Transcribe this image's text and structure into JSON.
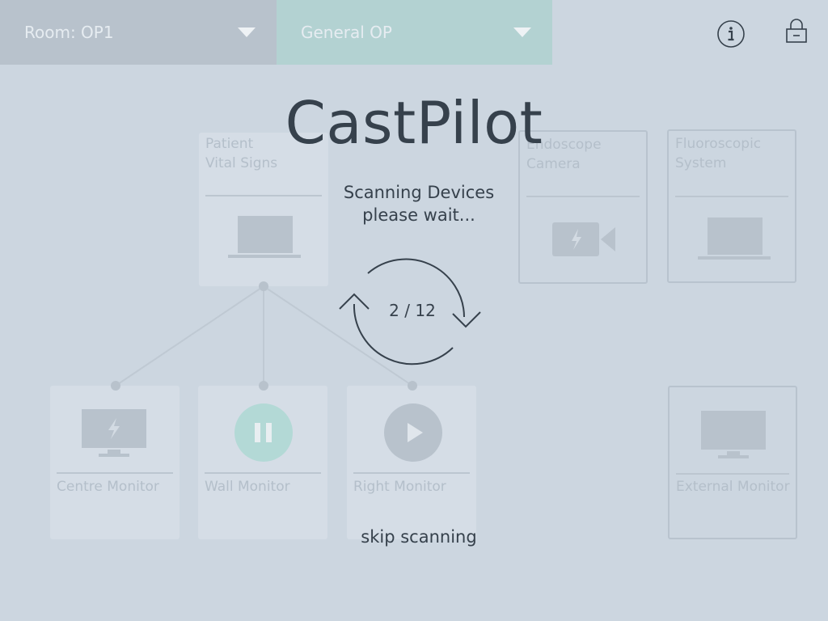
{
  "header": {
    "room_dropdown": "Room: OP1",
    "mode_dropdown": "General OP",
    "info_icon": "info-icon",
    "lock_icon": "lock-icon"
  },
  "overlay": {
    "app_title": "CastPilot",
    "scan_line1": "Scanning Devices",
    "scan_line2": "please wait...",
    "progress": "2 / 12",
    "skip": "skip scanning"
  },
  "devices": {
    "sources": [
      {
        "label": "Patient\nVital Signs",
        "icon": "laptop-icon"
      },
      {
        "label": "Endoscope\nCamera",
        "icon": "camera-icon"
      },
      {
        "label": "Fluoroscopic\nSystem",
        "icon": "laptop-icon"
      }
    ],
    "displays": [
      {
        "label": "Centre Monitor",
        "icon": "monitor-icon"
      },
      {
        "label": "Wall Monitor",
        "icon": "pause-icon"
      },
      {
        "label": "Right Monitor",
        "icon": "play-icon"
      },
      {
        "label": "External Monitor",
        "icon": "monitor-icon"
      }
    ]
  },
  "colors": {
    "background": "#ccd6e0",
    "room_dropdown": "#b8c2cc",
    "mode_dropdown": "#b3d2d2",
    "text_dark": "#36414c",
    "accent_teal": "#b3d9d6"
  }
}
